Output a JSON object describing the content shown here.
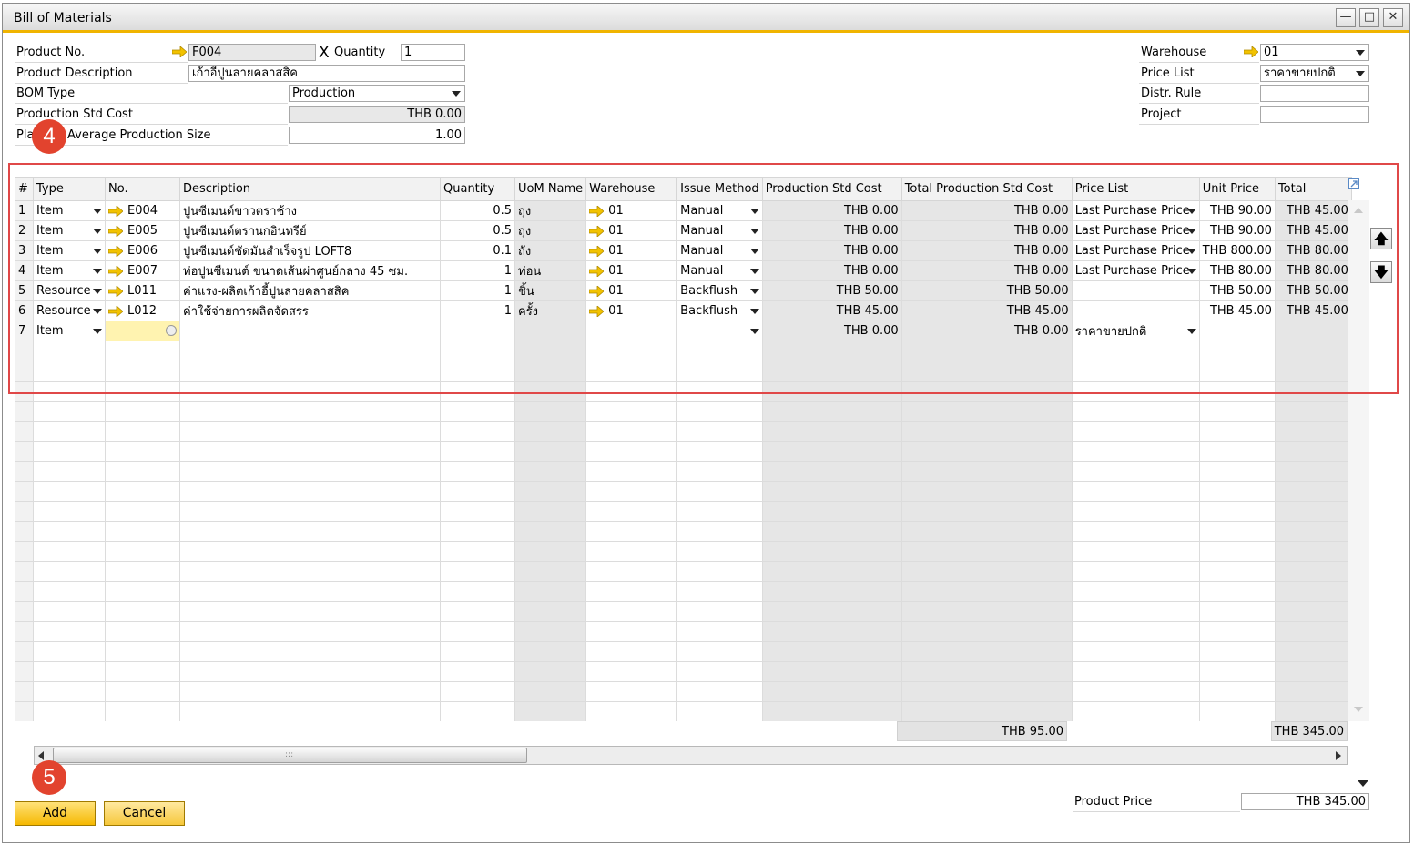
{
  "window": {
    "title": "Bill of Materials"
  },
  "header": {
    "product_no_label": "Product No.",
    "product_no": "F004",
    "x_label": "X",
    "quantity_label": "Quantity",
    "quantity": "1",
    "product_description_label": "Product Description",
    "product_description": "เก้าอี้ปูนลายคลาสสิค",
    "bom_type_label": "BOM Type",
    "bom_type": "Production",
    "production_std_cost_label": "Production Std Cost",
    "production_std_cost": "THB 0.00",
    "planned_avg_label_start": "Pla",
    "planned_avg_label_end": "Average Production Size",
    "planned_avg": "1.00",
    "warehouse_label": "Warehouse",
    "warehouse": "01",
    "price_list_label": "Price List",
    "price_list": "ราคาขายปกติ",
    "distr_rule_label": "Distr. Rule",
    "distr_rule": "",
    "project_label": "Project",
    "project": ""
  },
  "grid": {
    "columns": [
      "#",
      "Type",
      "No.",
      "Description",
      "Quantity",
      "UoM Name",
      "Warehouse",
      "Issue Method",
      "Production Std Cost",
      "Total Production Std Cost",
      "Price List",
      "Unit Price",
      "Total"
    ],
    "rows": [
      {
        "n": "1",
        "type": "Item",
        "no": "E004",
        "desc": "ปูนซีเมนต์ขาวตราช้าง",
        "qty": "0.5",
        "uom": "ถุง",
        "wh": "01",
        "issue": "Manual",
        "std": "THB 0.00",
        "tstd": "THB 0.00",
        "pl": "Last Purchase Price",
        "up": "THB 90.00",
        "total": "THB 45.00"
      },
      {
        "n": "2",
        "type": "Item",
        "no": "E005",
        "desc": "ปูนซีเมนต์ตรานกอินทรีย์",
        "qty": "0.5",
        "uom": "ถุง",
        "wh": "01",
        "issue": "Manual",
        "std": "THB 0.00",
        "tstd": "THB 0.00",
        "pl": "Last Purchase Price",
        "up": "THB 90.00",
        "total": "THB 45.00"
      },
      {
        "n": "3",
        "type": "Item",
        "no": "E006",
        "desc": "ปูนซีเมนต์ชัดมันสำเร็จรูป LOFT8",
        "qty": "0.1",
        "uom": "ถัง",
        "wh": "01",
        "issue": "Manual",
        "std": "THB 0.00",
        "tstd": "THB 0.00",
        "pl": "Last Purchase Price",
        "up": "THB 800.00",
        "total": "THB 80.00"
      },
      {
        "n": "4",
        "type": "Item",
        "no": "E007",
        "desc": "ท่อปูนซีเมนต์ ขนาดเส้นผ่าศูนย์กลาง 45 ซม.",
        "qty": "1",
        "uom": "ท่อน",
        "wh": "01",
        "issue": "Manual",
        "std": "THB 0.00",
        "tstd": "THB 0.00",
        "pl": "Last Purchase Price",
        "up": "THB 80.00",
        "total": "THB 80.00"
      },
      {
        "n": "5",
        "type": "Resource",
        "no": "L011",
        "desc": "ค่าแรง-ผลิตเก้าอี้ปูนลายคลาสสิค",
        "qty": "1",
        "uom": "ชิ้น",
        "wh": "01",
        "issue": "Backflush",
        "std": "THB 50.00",
        "tstd": "THB 50.00",
        "pl": "",
        "up": "THB 50.00",
        "total": "THB 50.00"
      },
      {
        "n": "6",
        "type": "Resource",
        "no": "L012",
        "desc": "ค่าใช้จ่ายการผลิตจัดสรร",
        "qty": "1",
        "uom": "ครั้ง",
        "wh": "01",
        "issue": "Backflush",
        "std": "THB 45.00",
        "tstd": "THB 45.00",
        "pl": "",
        "up": "THB 45.00",
        "total": "THB 45.00"
      },
      {
        "n": "7",
        "type": "Item",
        "no": "",
        "desc": "",
        "qty": "",
        "uom": "",
        "wh": "",
        "issue": "",
        "std": "THB 0.00",
        "tstd": "THB 0.00",
        "pl": "ราคาขายปกติ",
        "up": "",
        "total": ""
      }
    ],
    "total_std": "THB 95.00",
    "total_sum": "THB 345.00"
  },
  "footer": {
    "add_label": "Add",
    "cancel_label": "Cancel",
    "product_price_label": "Product Price",
    "product_price": "THB 345.00"
  },
  "annotations": {
    "badge_4": "4",
    "badge_5": "5",
    "highlight_color": "#e04848"
  },
  "colors": {
    "accent": "#f0b400",
    "button": "#f5b800",
    "badge": "#e2432e"
  }
}
